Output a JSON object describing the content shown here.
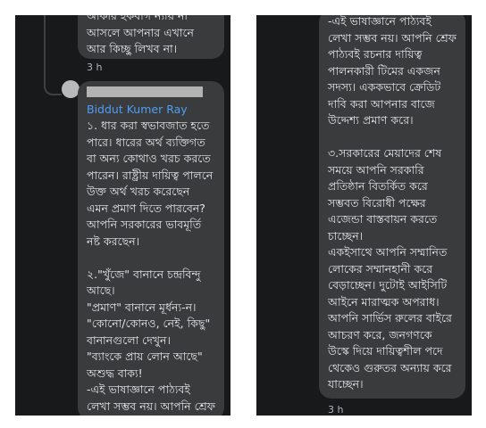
{
  "colors": {
    "panel_background": "#18191a",
    "bubble_background": "#3a3b3c",
    "text": "#e4e6eb",
    "author_link": "#4e9ef5",
    "timestamp": "#b0b3b8"
  },
  "left": {
    "prev_comment": {
      "lines": [
        "আকার হকবাগ ন্যায় না",
        "আসলে আপনার এখানে",
        "আর কিচ্ছু লিখব না।"
      ],
      "time": "3 h"
    },
    "reply": {
      "author": "Biddut Kumer Ray",
      "lines": [
        "১. ধার করা স্বভাবজাত হতে",
        "পারে। ধারের অর্থ ব্যক্তিগত",
        "বা অন্য কোথাও খরচ করতে",
        "পারেন। রাষ্ট্রীয় দায়িত্ব পালনে",
        "উক্ত অর্থ খরচ করেছেন",
        "এমন প্রমাণ দিতে পারবেন?",
        "আপনি সরকারের ভাবমূর্তি",
        "নষ্ট করছেন।",
        "",
        "২.\"খুঁজে\" বানানে চন্দ্রবিন্দু",
        "আছে।",
        "\"প্রমাণ\" বানানে মূর্ধন্য-ন।",
        "\"কোনো/কোনও, নেই, কিছু\"",
        "বানানগুলো দেখুন।",
        "\"ব্যাংকে প্রায় লোন আছে\"",
        "অশুদ্ধ বাক্য!",
        "-এই ভাষাজ্ঞানে পাঠ্যবই",
        "লেখা সম্ভব নয়। আপনি শ্রেফ"
      ]
    }
  },
  "right": {
    "continuation": {
      "lines": [
        "-এই ভাষাজ্ঞানে পাঠ্যবই",
        "লেখা সম্ভব নয়। আপনি শ্রেফ",
        "পাঠ্যবই রচনার দায়িত্ব",
        "পালনকারী টিমের একজন",
        "সদস্য। এককভাবে ক্রেডিট",
        "দাবি করা আপনার বাজে",
        "উদ্দেশ্য প্রমাণ করে।",
        "",
        "৩.সরকারের মেয়াদের শেষ",
        "সময়ে আপনি সরকারি",
        "প্রতিষ্ঠান বিতর্কিত করে",
        "সম্ভবত বিরোধী পক্ষের",
        "এজেন্ডা বাস্তবায়ন করতে",
        "চাচ্ছেন।",
        "একইসাথে আপনি সম্মানিত",
        "লোকের সম্মানহানী করে",
        "বেড়াচ্ছেন। দুটোই আইসিটি",
        "আইনে মারাত্মক অপরাধ।",
        "আপনি সার্ভিস রুলের বাইরে",
        "আচরণ করে, জনগণকে",
        "উস্কে দিয়ে দায়িত্বশীল পদে",
        "থেকেও গুরুতর অন্যায় করে",
        "যাচ্ছেন।"
      ],
      "time": "3 h"
    }
  }
}
